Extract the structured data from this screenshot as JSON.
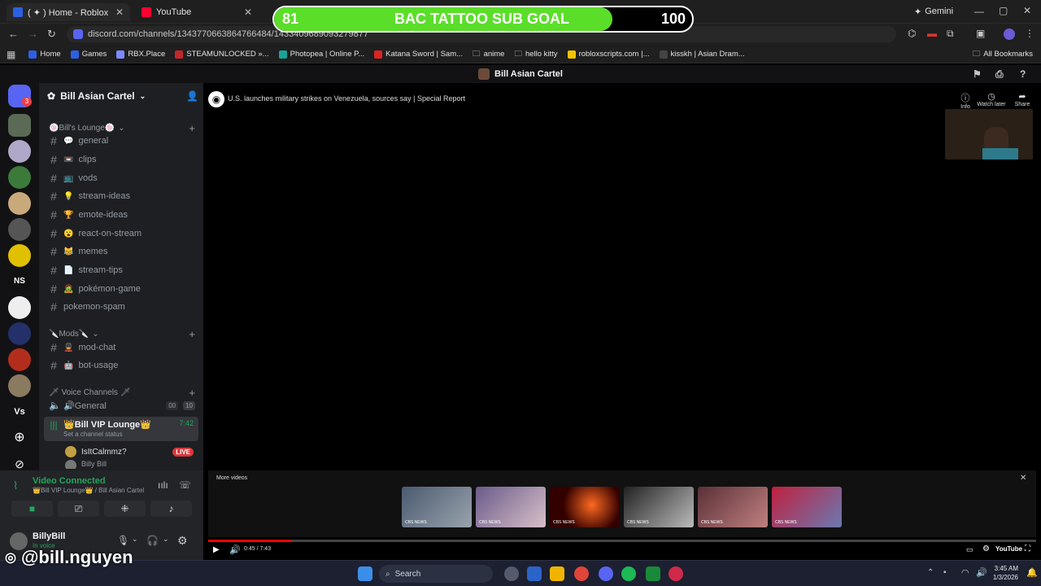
{
  "browser": {
    "tabs": [
      {
        "label": "( ✦ ) Home - Roblox",
        "fav": "#2c5fe3"
      },
      {
        "label": "YouTube",
        "fav": "#ff0033"
      }
    ],
    "url": "discord.com/channels/1343770663864766484/1433409689093279877",
    "gemini_label": "Gemini",
    "bookmarks": [
      "Home",
      "Games",
      "RBX.Place",
      "STEAMUNLOCKED »...",
      "Photopea | Online P...",
      "Katana Sword | Sam...",
      "anime",
      "hello kitty",
      "robloxscripts.com |...",
      "kisskh | Asian Dram..."
    ],
    "all_bookmarks": "All Bookmarks"
  },
  "goal": {
    "current": "81",
    "title": "BAC TATTOO SUB GOAL",
    "target": "100",
    "progress": 0.81,
    "fill_color": "#5bde2a"
  },
  "discord": {
    "server_title": "Bill Asian Cartel",
    "server_name": "Bill Asian Cartel",
    "rail_badge": "3",
    "rail_vs": "Vs",
    "rail_ns": "NS",
    "categories": {
      "lounge": "🍥Bill's Lounge🍥",
      "mods": "🔪Mods🔪",
      "voice": "🗡 Voice Channels 🗡"
    },
    "channels": [
      {
        "emoji": "💬",
        "name": "general"
      },
      {
        "emoji": "📼",
        "name": "clips"
      },
      {
        "emoji": "📺",
        "name": "vods"
      },
      {
        "emoji": "💡",
        "name": "stream-ideas"
      },
      {
        "emoji": "🏆",
        "name": "emote-ideas"
      },
      {
        "emoji": "😮",
        "name": "react-on-stream"
      },
      {
        "emoji": "😹",
        "name": "memes"
      },
      {
        "emoji": "📄",
        "name": "stream-tips"
      },
      {
        "emoji": "🧟",
        "name": "pokémon-game"
      },
      {
        "emoji": "",
        "name": "pokemon-spam"
      }
    ],
    "mod_channels": [
      {
        "emoji": "💂",
        "name": "mod-chat"
      },
      {
        "emoji": "🤖",
        "name": "bot-usage"
      }
    ],
    "voice_general": {
      "name": "🔊General",
      "count_a": "00",
      "count_b": "10"
    },
    "voice_vip": {
      "name": "👑Bill VIP Lounge👑",
      "time": "7:42",
      "status": "Set a channel status"
    },
    "voice_users": [
      {
        "name": "IsItCalmmz?",
        "badge": "LIVE"
      },
      {
        "name": "Billy Bill",
        "badge": ""
      }
    ],
    "connection": {
      "status": "Video Connected",
      "detail": "👑Bill VIP Lounge👑 / Bill Asian Cartel"
    },
    "user": {
      "name": "BillyBill",
      "status": "In voice"
    }
  },
  "video": {
    "title": "U.S. launches military strikes on Venezuela, sources say | Special Report",
    "actions": [
      "Info",
      "Watch later",
      "Share"
    ],
    "more_videos": "More videos",
    "time": "0:45 / 7:43",
    "progress": 0.1,
    "brand": "YouTube",
    "thumbs_label": "CBS NEWS"
  },
  "overlay_handle": "@bill.nguyen",
  "taskbar": {
    "search": "Search",
    "time": "3:45 AM",
    "date": "1/3/2026"
  }
}
